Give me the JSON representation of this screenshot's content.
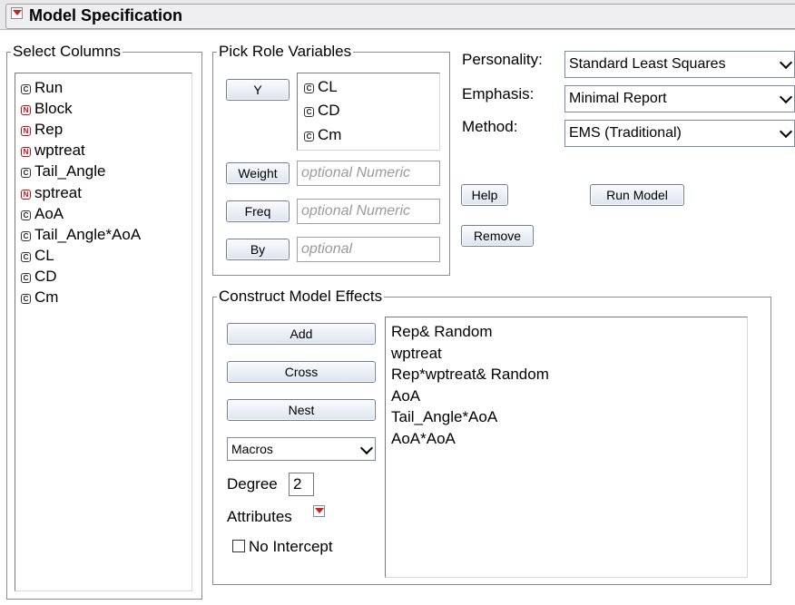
{
  "title": "Model Specification",
  "select_columns": {
    "legend": "Select Columns",
    "items": [
      {
        "label": "Run",
        "type": "continuous"
      },
      {
        "label": "Block",
        "type": "nominal"
      },
      {
        "label": "Rep",
        "type": "nominal"
      },
      {
        "label": "wptreat",
        "type": "nominal"
      },
      {
        "label": "Tail_Angle",
        "type": "continuous"
      },
      {
        "label": "sptreat",
        "type": "nominal"
      },
      {
        "label": "AoA",
        "type": "continuous"
      },
      {
        "label": "Tail_Angle*AoA",
        "type": "continuous"
      },
      {
        "label": "CL",
        "type": "continuous"
      },
      {
        "label": "CD",
        "type": "continuous"
      },
      {
        "label": "Cm",
        "type": "continuous"
      }
    ]
  },
  "role_variables": {
    "legend": "Pick Role Variables",
    "y_label": "Y",
    "y_items": [
      "CL",
      "CD",
      "Cm"
    ],
    "weight_label": "Weight",
    "weight_placeholder": "optional Numeric",
    "freq_label": "Freq",
    "freq_placeholder": "optional Numeric",
    "by_label": "By",
    "by_placeholder": "optional"
  },
  "options": {
    "personality_label": "Personality:",
    "personality_value": "Standard Least Squares",
    "emphasis_label": "Emphasis:",
    "emphasis_value": "Minimal Report",
    "method_label": "Method:",
    "method_value": "EMS (Traditional)"
  },
  "actions": {
    "help": "Help",
    "run_model": "Run Model",
    "remove": "Remove"
  },
  "effects": {
    "legend": "Construct Model Effects",
    "add": "Add",
    "cross": "Cross",
    "nest": "Nest",
    "macros": "Macros",
    "degree_label": "Degree",
    "degree_value": "2",
    "attributes_label": "Attributes",
    "no_intercept_label": "No Intercept",
    "items": [
      "Rep& Random",
      "wptreat",
      "Rep*wptreat& Random",
      "AoA",
      "Tail_Angle*AoA",
      "AoA*AoA"
    ]
  },
  "icons": {
    "continuous": "C",
    "nominal": "N",
    "red_triangle": "red-triangle-menu-icon"
  },
  "colors": {
    "nominal": "#c0101a",
    "red_triangle": "#d0201a",
    "button_border": "#6f7f99"
  }
}
